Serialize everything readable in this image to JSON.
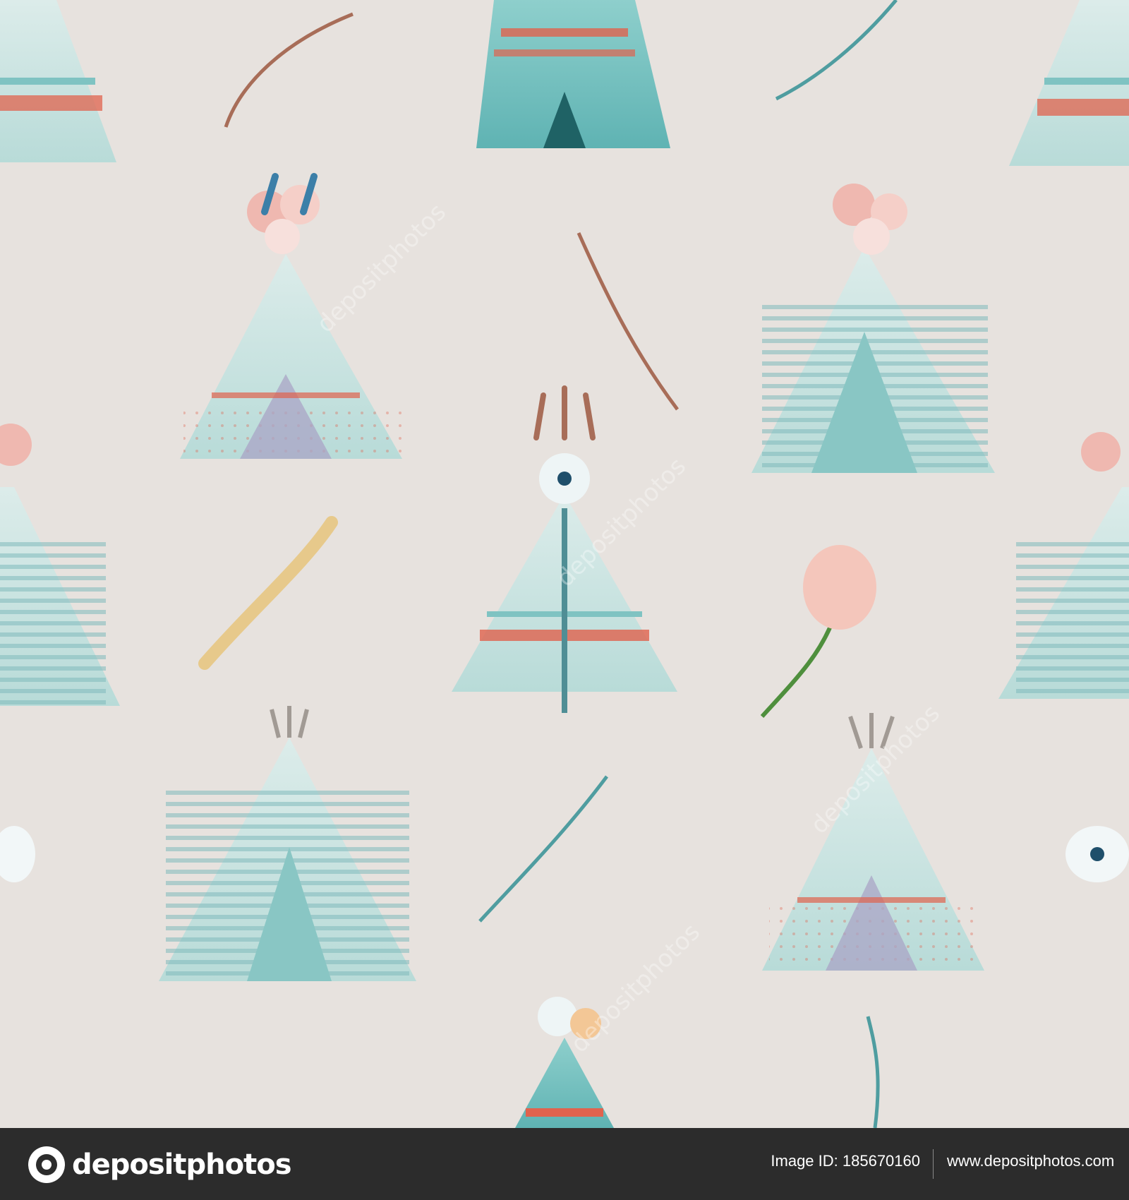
{
  "footer": {
    "brand": "depositphotos",
    "image_id": "Image ID: 185670160",
    "site": "www.depositphotos.com"
  },
  "watermark": "depositphotos",
  "colors": {
    "background": "#e7e2de",
    "teal": "#7fc3c2",
    "light_teal": "#bfe0de",
    "coral": "#e0634e",
    "pink": "#efb8b0",
    "brown": "#a86d58",
    "footer_bg": "#2c2c2c"
  }
}
